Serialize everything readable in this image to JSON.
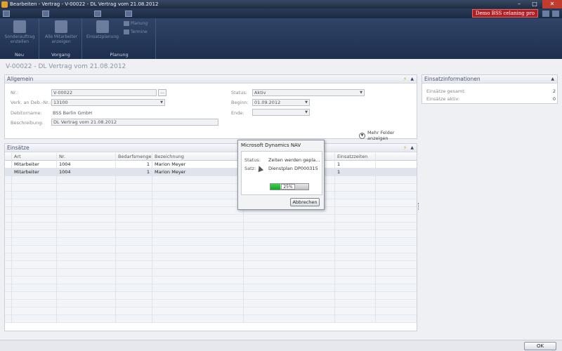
{
  "window": {
    "title": "Bearbeiten - Vertrag - V-00022 - DL Vertrag vom 21.08.2012",
    "minimize": "–",
    "maximize": "□",
    "close": "✕"
  },
  "quickbar": {
    "demo_badge": "Demo BSS celaning pro"
  },
  "ribbon": {
    "groups": [
      {
        "label": "Neu",
        "buttons": [
          {
            "label": "Sonderauftrag erstellen",
            "icon": "document-icon"
          }
        ]
      },
      {
        "label": "Vorgang",
        "buttons": [
          {
            "label": "Alle Mitarbeiter anzeigen",
            "icon": "filter-icon"
          }
        ]
      },
      {
        "label": "Planung",
        "buttons": [
          {
            "label": "Einsatzplanung",
            "icon": "calendar-icon"
          }
        ],
        "small": [
          "Planung",
          "Termine"
        ]
      }
    ]
  },
  "page": {
    "title": "V-00022 - DL Vertrag vom 21.08.2012"
  },
  "allgemein": {
    "header": "Allgemein",
    "fields": {
      "nr_label": "Nr.:",
      "nr_value": "V-00022",
      "verk_label": "Verk. an Deb.-Nr.:",
      "verk_value": "13100",
      "debname_label": "Debitorname:",
      "debname_value": "BSS Berlin GmbH",
      "beschr_label": "Beschreibung:",
      "beschr_value": "DL Vertrag vom 21.08.2012",
      "status_label": "Status:",
      "status_value": "Aktiv",
      "beginn_label": "Beginn:",
      "beginn_value": "01.09.2012",
      "ende_label": "Ende:",
      "ende_value": ""
    },
    "more_fields": "Mehr Felder anzeigen",
    "ellipsis": "..."
  },
  "einsaetze": {
    "header": "Einsätze",
    "columns": [
      "Art",
      "Nr.",
      "Bedarfsmenge",
      "Bezeichnung",
      "",
      "Einsatzzeiten"
    ],
    "rows": [
      [
        "Mitarbeiter",
        "1004",
        "1",
        "Marion Meyer",
        "",
        "1"
      ],
      [
        "Mitarbeiter",
        "1004",
        "1",
        "Marion Meyer",
        "",
        "1"
      ]
    ]
  },
  "einsatzinfo": {
    "header": "Einsatzinformationen",
    "rows": [
      {
        "label": "Einsätze gesamt:",
        "value": "2"
      },
      {
        "label": "Einsätze aktiv:",
        "value": "0"
      }
    ]
  },
  "dialog": {
    "title": "Microsoft Dynamics NAV",
    "status_label": "Status:",
    "status_value": "Zeiten werden gepla...",
    "satz_label": "Satz:",
    "satz_value": "Dienstplan DP000315",
    "progress_percent": 25,
    "progress_text": "25%",
    "cancel": "Abbrechen"
  },
  "footer": {
    "ok": "OK"
  },
  "colors": {
    "accent_red": "#b21f22",
    "progress_green": "#13a524",
    "ribbon_blue": "#2f4468"
  }
}
